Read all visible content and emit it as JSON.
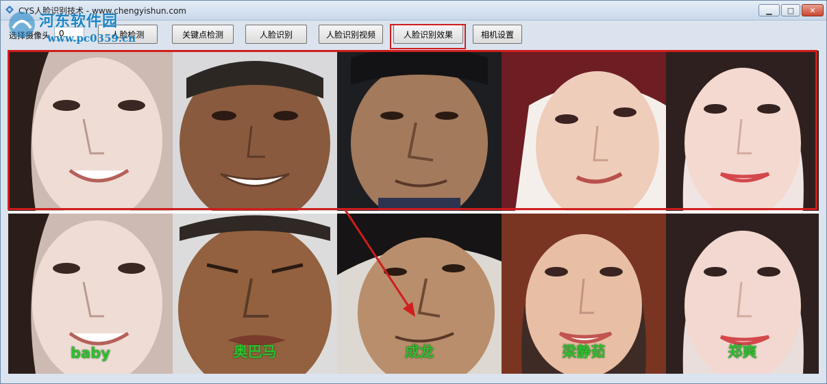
{
  "window": {
    "title": "CYS人脸识别技术  -   www.chengyishun.com",
    "minimize_icon": "minimize-icon",
    "maximize_icon": "maximize-icon",
    "close_icon": "close-icon"
  },
  "toolbar": {
    "camera_label": "选择摄像头",
    "camera_value": "0",
    "buttons": [
      {
        "label": "人脸检测"
      },
      {
        "label": "关键点检测"
      },
      {
        "label": "人脸识别"
      },
      {
        "label": "人脸识别视频"
      },
      {
        "label": "人脸识别效果"
      },
      {
        "label": "相机设置"
      }
    ]
  },
  "watermark": {
    "name": "河东软件园",
    "url": "www.pc0359.cn"
  },
  "results": {
    "names": [
      "baby",
      "奥巴马",
      "成龙",
      "梁静茹",
      "郑爽"
    ]
  },
  "colors": {
    "highlight": "#d01d1d",
    "label_green": "#2fbf2f"
  }
}
